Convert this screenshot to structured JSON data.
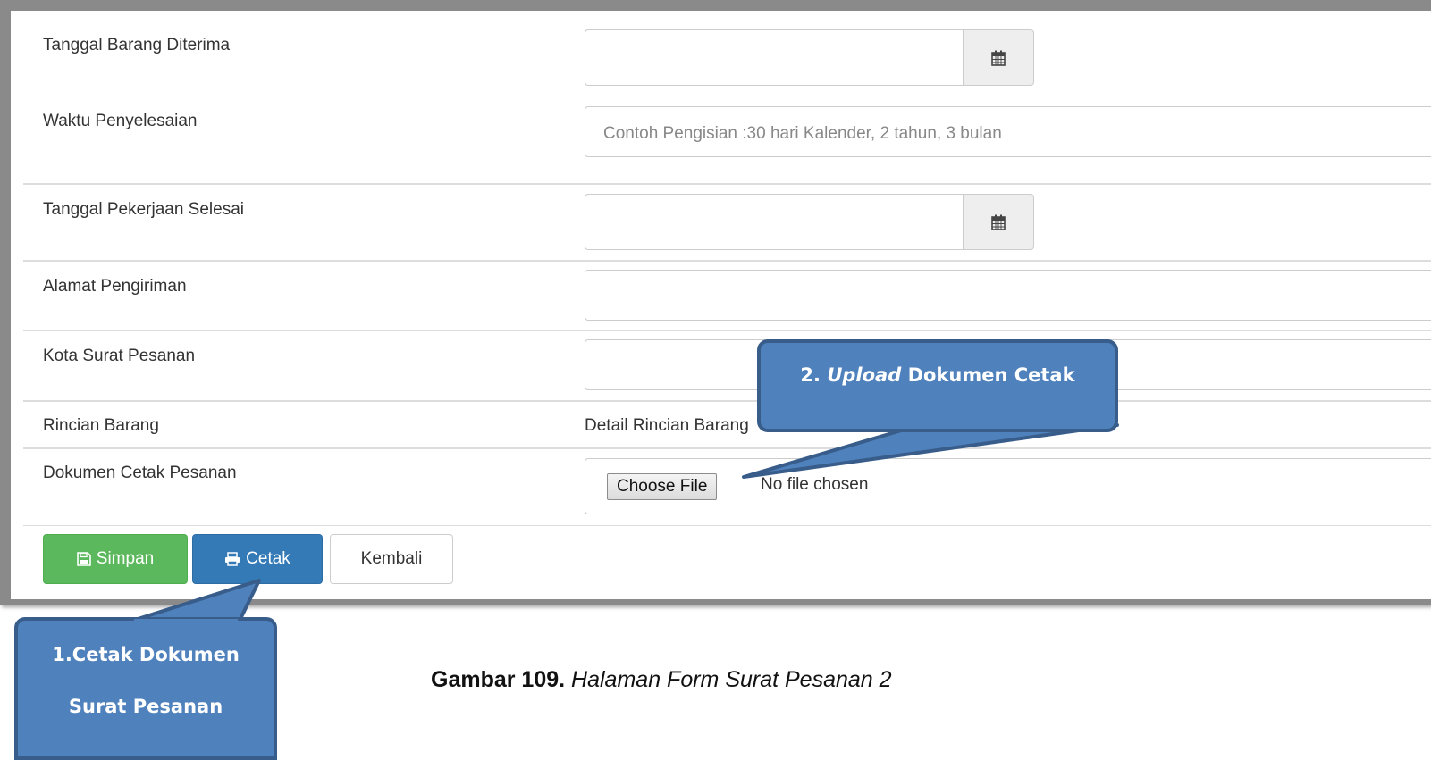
{
  "form": {
    "fields": [
      {
        "label": "Tanggal Barang Diterima",
        "value": ""
      },
      {
        "label": "Waktu Penyelesaian",
        "placeholder": "Contoh Pengisian :30 hari Kalender, 2 tahun, 3 bulan"
      },
      {
        "label": "Tanggal Pekerjaan Selesai",
        "value": ""
      },
      {
        "label": "Alamat Pengiriman",
        "value": ""
      },
      {
        "label": "Kota Surat Pesanan",
        "value": ""
      },
      {
        "label": "Rincian Barang",
        "link": "Detail Rincian Barang"
      },
      {
        "label": "Dokumen Cetak Pesanan",
        "file_button": "Choose File",
        "file_status": "No file chosen"
      }
    ],
    "calendar_icon": "calendar-icon"
  },
  "buttons": {
    "save": {
      "label": "Simpan",
      "icon": "save-icon",
      "color": "#5cb85c"
    },
    "print": {
      "label": "Cetak",
      "icon": "print-icon",
      "color": "#337ab7"
    },
    "back": {
      "label": "Kembali"
    }
  },
  "callouts": {
    "upload_number": "2.",
    "upload_italic": "Upload",
    "upload_rest": "Dokumen Cetak",
    "print_line1": "1.Cetak Dokumen",
    "print_line2": "Surat Pesanan",
    "color": "#4f81bd"
  },
  "caption": {
    "bold": "Gambar 109.",
    "italic": "Halaman Form Surat Pesanan 2"
  }
}
